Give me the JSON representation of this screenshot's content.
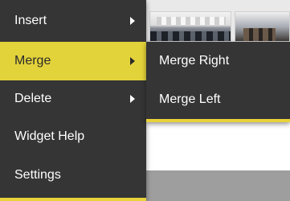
{
  "context_menu": {
    "items": [
      {
        "label": "Insert",
        "has_submenu": true,
        "active": false
      },
      {
        "label": "Merge",
        "has_submenu": true,
        "active": true
      },
      {
        "label": "Delete",
        "has_submenu": true,
        "active": false
      },
      {
        "label": "Widget Help",
        "has_submenu": false,
        "active": false
      },
      {
        "label": "Settings",
        "has_submenu": false,
        "active": false
      }
    ]
  },
  "submenu": {
    "parent": "Merge",
    "items": [
      {
        "label": "Merge Right"
      },
      {
        "label": "Merge Left"
      }
    ]
  },
  "theme": {
    "menu_bg": "#353535",
    "accent": "#e3d33a",
    "text": "#ffffff"
  },
  "icons": {
    "submenu_arrow": "chevron-right-icon"
  }
}
